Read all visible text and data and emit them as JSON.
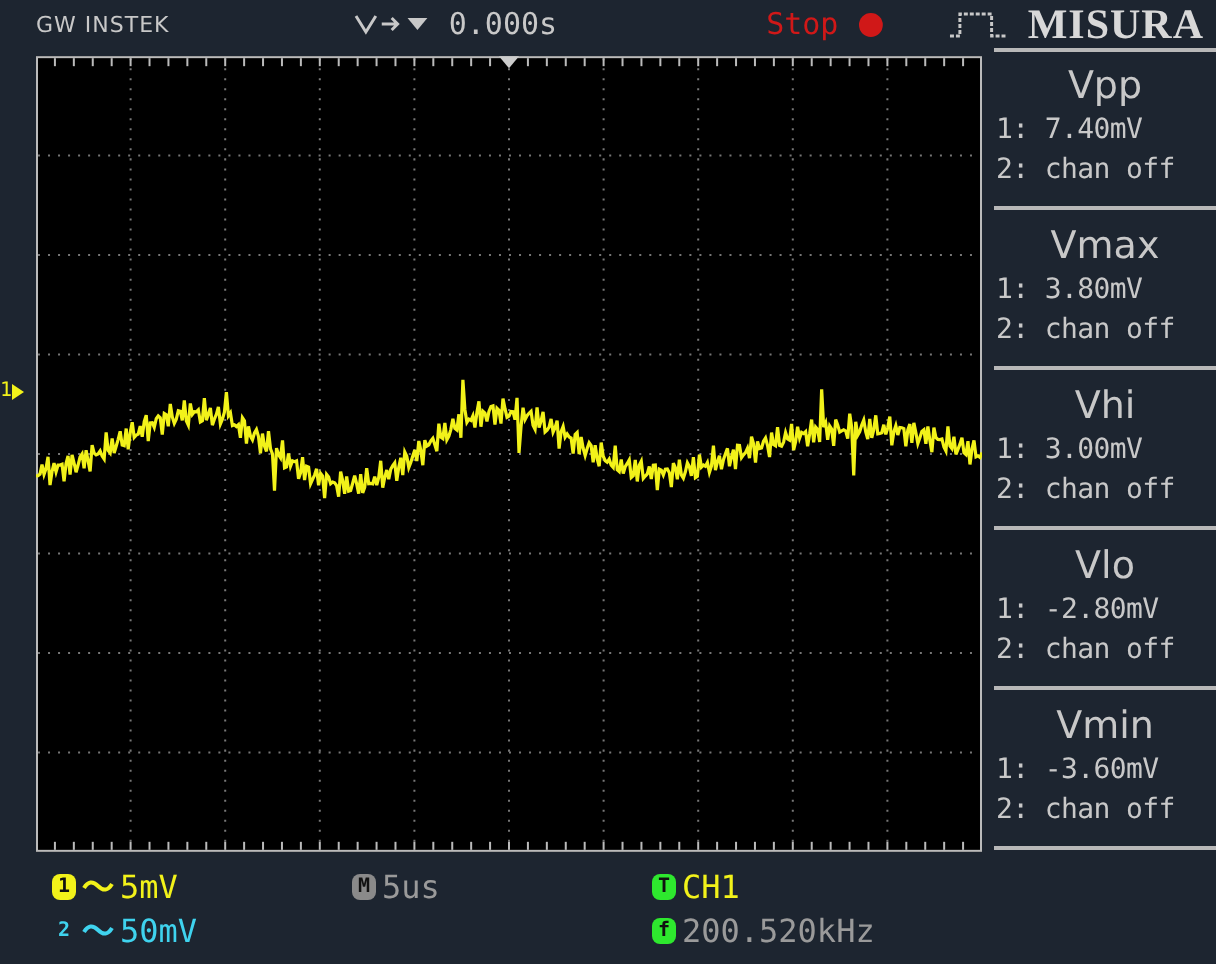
{
  "header": {
    "brand": "GW INSTEK",
    "trigger_time": "0.000s",
    "run_state": "Stop",
    "running": false,
    "overlay_label": "MISURA"
  },
  "channel_marker": "1",
  "measurements": [
    {
      "name": "Vpp",
      "readings": [
        "1: 7.40mV",
        "2: chan off"
      ]
    },
    {
      "name": "Vmax",
      "readings": [
        "1: 3.80mV",
        "2: chan off"
      ]
    },
    {
      "name": "Vhi",
      "readings": [
        "1: 3.00mV",
        "2: chan off"
      ]
    },
    {
      "name": "Vlo",
      "readings": [
        "1: -2.80mV",
        "2: chan off"
      ]
    },
    {
      "name": "Vmin",
      "readings": [
        "1: -3.60mV",
        "2: chan off"
      ]
    }
  ],
  "footer": {
    "channels": [
      {
        "marker": "1",
        "boxed": true,
        "scale": "5mV",
        "color": "#f2f21a"
      },
      {
        "marker": "2",
        "boxed": false,
        "scale": "50mV",
        "color": "#3fd3ee"
      }
    ],
    "timebase": {
      "marker": "M",
      "value": "5us"
    },
    "trigger": {
      "marker": "T",
      "source": "CH1"
    },
    "frequency": {
      "marker": "f",
      "value": "200.520kHz"
    }
  }
}
